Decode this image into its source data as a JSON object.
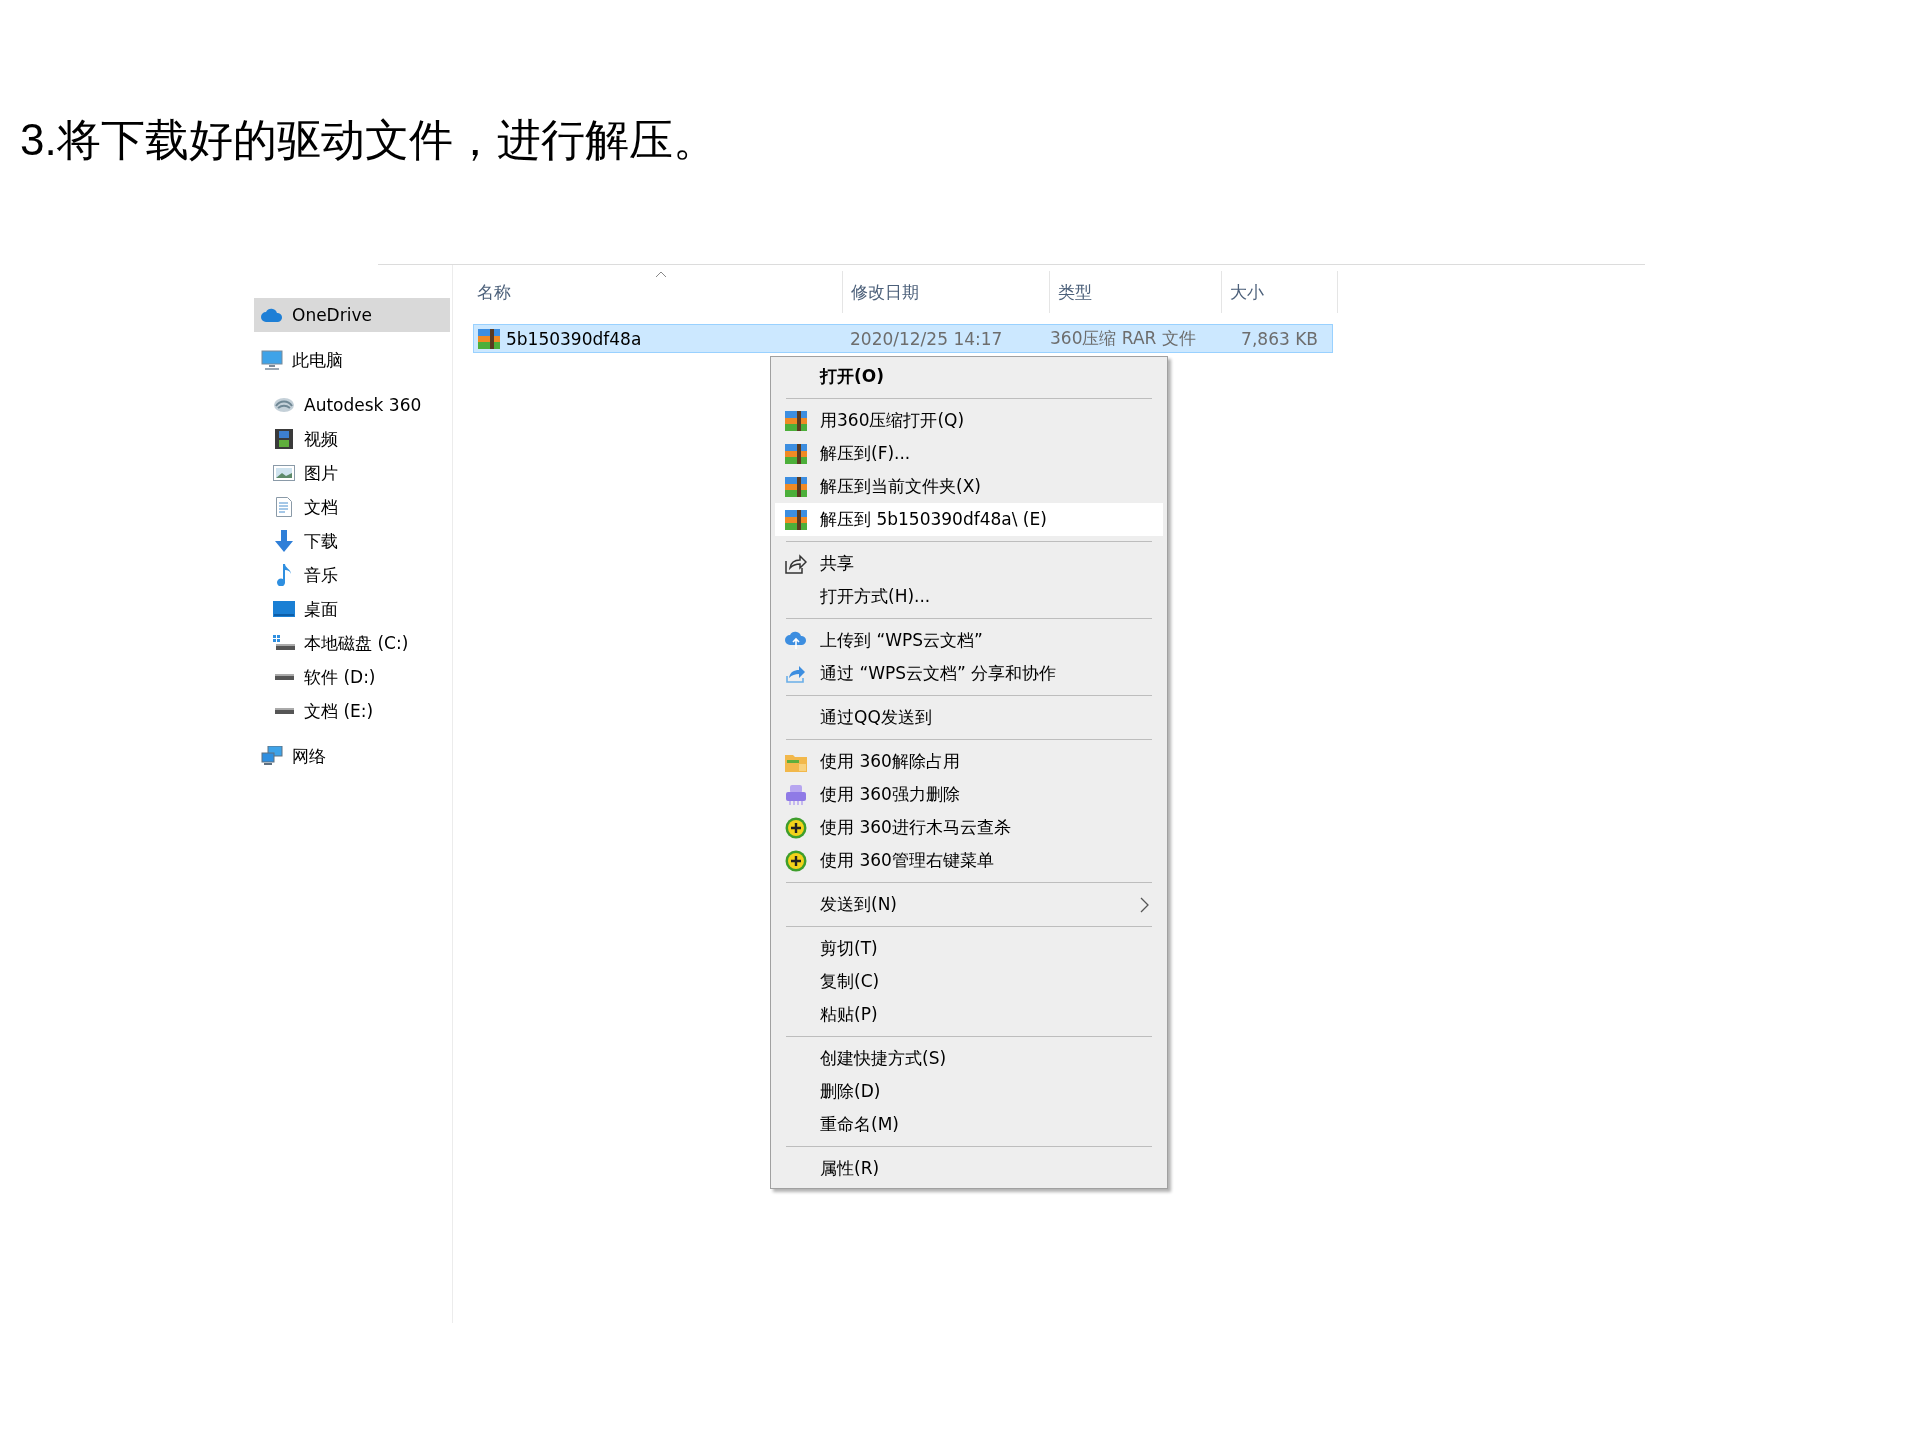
{
  "heading": "3.将下载好的驱动文件，进行解压。",
  "sidebar": {
    "items": [
      {
        "label": "OneDrive",
        "kind": "cloud",
        "selected": true
      },
      {
        "label": "此电脑",
        "kind": "computer",
        "selected": false,
        "children": [
          {
            "label": "Autodesk 360",
            "kind": "autodesk",
            "selected": false
          },
          {
            "label": "视频",
            "kind": "video",
            "selected": false
          },
          {
            "label": "图片",
            "kind": "picture",
            "selected": false
          },
          {
            "label": "文档",
            "kind": "document",
            "selected": false
          },
          {
            "label": "下载",
            "kind": "download",
            "selected": false
          },
          {
            "label": "音乐",
            "kind": "music",
            "selected": false
          },
          {
            "label": "桌面",
            "kind": "desktop",
            "selected": false
          },
          {
            "label": "本地磁盘 (C:)",
            "kind": "system-drive",
            "selected": false
          },
          {
            "label": "软件 (D:)",
            "kind": "drive",
            "selected": false
          },
          {
            "label": "文档 (E:)",
            "kind": "drive",
            "selected": false
          }
        ]
      },
      {
        "label": "网络",
        "kind": "network",
        "selected": false
      }
    ]
  },
  "file_list": {
    "columns": [
      "名称",
      "修改日期",
      "类型",
      "大小"
    ],
    "rows": [
      {
        "name": "5b150390df48a",
        "modified": "2020/12/25 14:17",
        "type": "360压缩 RAR 文件",
        "size": "7,863 KB",
        "selected": true
      }
    ]
  },
  "context_menu": {
    "sections": [
      {
        "items": [
          {
            "label": "打开(O)",
            "kind": "plain",
            "default": true,
            "selected": false,
            "submenu": false
          }
        ]
      },
      {
        "items": [
          {
            "label": "用360压缩打开(Q)",
            "kind": "archive",
            "default": false,
            "selected": false,
            "submenu": false
          },
          {
            "label": "解压到(F)...",
            "kind": "archive",
            "default": false,
            "selected": false,
            "submenu": false
          },
          {
            "label": "解压到当前文件夹(X)",
            "kind": "archive",
            "default": false,
            "selected": false,
            "submenu": false
          },
          {
            "label": "解压到 5b150390df48a\\ (E)",
            "kind": "archive",
            "default": false,
            "selected": true,
            "submenu": false
          }
        ]
      },
      {
        "items": [
          {
            "label": "共享",
            "kind": "share",
            "default": false,
            "selected": false,
            "submenu": false
          },
          {
            "label": "打开方式(H)...",
            "kind": "plain",
            "default": false,
            "selected": false,
            "submenu": false
          }
        ]
      },
      {
        "items": [
          {
            "label": "上传到 “WPS云文档”",
            "kind": "cloud-upload",
            "default": false,
            "selected": false,
            "submenu": false
          },
          {
            "label": "通过 “WPS云文档” 分享和协作",
            "kind": "cloud-share",
            "default": false,
            "selected": false,
            "submenu": false
          }
        ]
      },
      {
        "items": [
          {
            "label": "通过QQ发送到",
            "kind": "plain",
            "default": false,
            "selected": false,
            "submenu": false
          }
        ]
      },
      {
        "items": [
          {
            "label": "使用 360解除占用",
            "kind": "unlock-folder",
            "default": false,
            "selected": false,
            "submenu": false
          },
          {
            "label": "使用 360强力删除",
            "kind": "shredder",
            "default": false,
            "selected": false,
            "submenu": false
          },
          {
            "label": "使用 360进行木马云查杀",
            "kind": "shield-plus",
            "default": false,
            "selected": false,
            "submenu": false
          },
          {
            "label": "使用 360管理右键菜单",
            "kind": "shield-plus",
            "default": false,
            "selected": false,
            "submenu": false
          }
        ]
      },
      {
        "items": [
          {
            "label": "发送到(N)",
            "kind": "plain",
            "default": false,
            "selected": false,
            "submenu": true
          }
        ]
      },
      {
        "items": [
          {
            "label": "剪切(T)",
            "kind": "plain",
            "default": false,
            "selected": false,
            "submenu": false
          },
          {
            "label": "复制(C)",
            "kind": "plain",
            "default": false,
            "selected": false,
            "submenu": false
          },
          {
            "label": "粘贴(P)",
            "kind": "plain",
            "default": false,
            "selected": false,
            "submenu": false
          }
        ]
      },
      {
        "items": [
          {
            "label": "创建快捷方式(S)",
            "kind": "plain",
            "default": false,
            "selected": false,
            "submenu": false
          },
          {
            "label": "删除(D)",
            "kind": "plain",
            "default": false,
            "selected": false,
            "submenu": false
          },
          {
            "label": "重命名(M)",
            "kind": "plain",
            "default": false,
            "selected": false,
            "submenu": false
          }
        ]
      },
      {
        "items": [
          {
            "label": "属性(R)",
            "kind": "plain",
            "default": false,
            "selected": false,
            "submenu": false
          }
        ]
      }
    ]
  }
}
